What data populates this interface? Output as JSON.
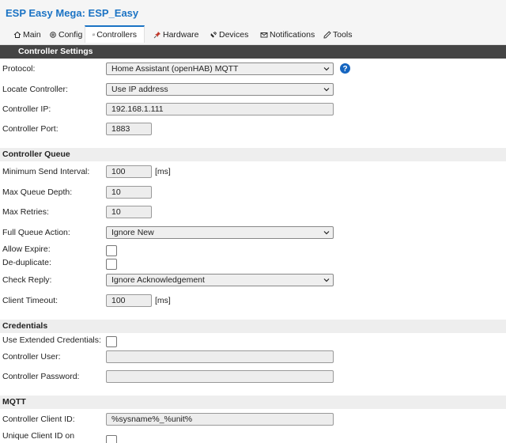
{
  "header": {
    "title": "ESP Easy Mega: ESP_Easy"
  },
  "tabs": [
    {
      "label": "Main"
    },
    {
      "label": "Config"
    },
    {
      "label": "Controllers"
    },
    {
      "label": "Hardware"
    },
    {
      "label": "Devices"
    },
    {
      "label": "Notifications"
    },
    {
      "label": "Tools"
    }
  ],
  "sections": {
    "controller_settings": "Controller Settings",
    "controller_queue": "Controller Queue",
    "credentials": "Credentials",
    "mqtt": "MQTT"
  },
  "settings": {
    "protocol_label": "Protocol:",
    "protocol_value": "Home Assistant (openHAB) MQTT",
    "locate_label": "Locate Controller:",
    "locate_value": "Use IP address",
    "ip_label": "Controller IP:",
    "ip_value": "192.168.1.111",
    "port_label": "Controller Port:",
    "port_value": "1883"
  },
  "queue": {
    "min_send_label": "Minimum Send Interval:",
    "min_send_value": "100",
    "min_send_unit": "[ms]",
    "max_depth_label": "Max Queue Depth:",
    "max_depth_value": "10",
    "max_retries_label": "Max Retries:",
    "max_retries_value": "10",
    "full_action_label": "Full Queue Action:",
    "full_action_value": "Ignore New",
    "allow_expire_label": "Allow Expire:",
    "dedup_label": "De-duplicate:",
    "check_reply_label": "Check Reply:",
    "check_reply_value": "Ignore Acknowledgement",
    "timeout_label": "Client Timeout:",
    "timeout_value": "100",
    "timeout_unit": "[ms]"
  },
  "credentials": {
    "extended_label": "Use Extended Credentials:",
    "user_label": "Controller User:",
    "user_value": "",
    "password_label": "Controller Password:",
    "password_value": ""
  },
  "mqtt": {
    "client_id_label": "Controller Client ID:",
    "client_id_value": "%sysname%_%unit%",
    "unique_id_label": "Unique Client ID on"
  },
  "colors": {
    "accent": "#1b73c4",
    "section_dark": "#444444",
    "section_light": "#eeeeee",
    "help_icon": "#1565c0"
  }
}
